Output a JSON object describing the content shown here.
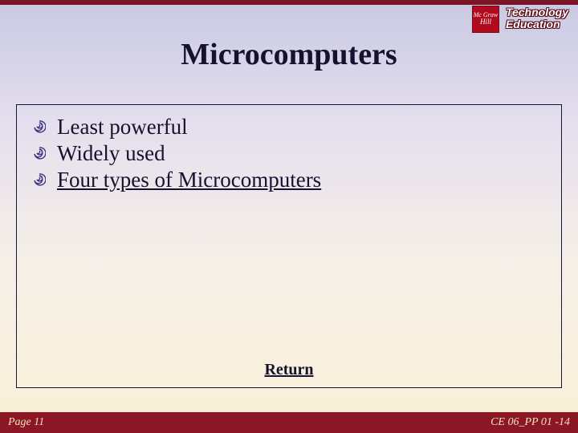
{
  "logo": {
    "mh_line1": "Mc Graw",
    "mh_line2": "Hill",
    "te_line1": "Technology",
    "te_line2": "Education"
  },
  "title": "Microcomputers",
  "bullets": [
    {
      "text": "Least powerful",
      "link": false
    },
    {
      "text": "Widely used",
      "link": false
    },
    {
      "text": "Four types of Microcomputers",
      "link": true
    }
  ],
  "return_label": "Return",
  "footer": {
    "left": "Page 11",
    "right": "CE 06_PP 01 -14"
  }
}
